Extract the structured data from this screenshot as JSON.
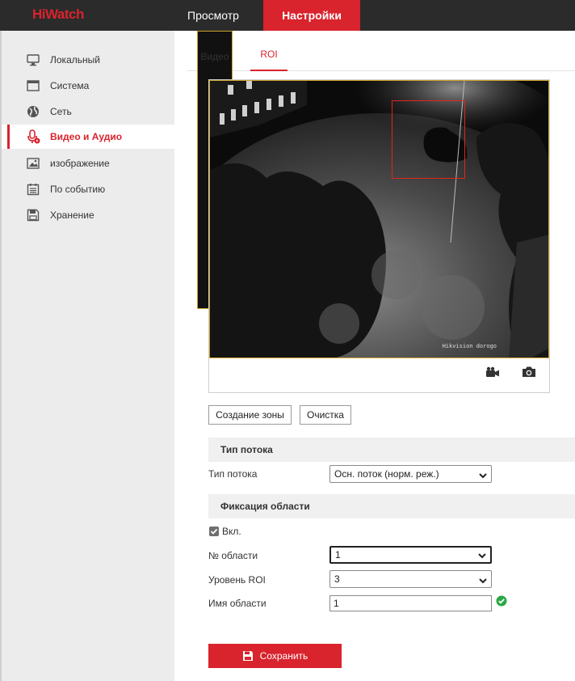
{
  "app": {
    "brand": "HiWatch"
  },
  "top_nav": {
    "view": "Просмотр",
    "settings": "Настройки"
  },
  "sidebar": {
    "items": [
      {
        "label": "Локальный",
        "icon": "monitor-icon"
      },
      {
        "label": "Система",
        "icon": "window-icon"
      },
      {
        "label": "Сеть",
        "icon": "globe-icon"
      },
      {
        "label": "Видео и Аудио",
        "icon": "microphone-icon",
        "active": true
      },
      {
        "label": "изображение",
        "icon": "image-icon"
      },
      {
        "label": "По событию",
        "icon": "calendar-icon"
      },
      {
        "label": "Хранение",
        "icon": "floppy-icon"
      }
    ]
  },
  "tabs": {
    "video": "Видео",
    "roi": "ROI"
  },
  "video": {
    "osd_text": "Hikvision dorogo"
  },
  "buttons": {
    "create_zone": "Создание зоны",
    "clear": "Очистка",
    "save": "Сохранить"
  },
  "stream_section": {
    "title": "Тип потока",
    "type_label": "Тип потока",
    "type_value": "Осн. поток (норм. реж.)"
  },
  "region_section": {
    "title": "Фиксация области",
    "enable_label": "Вкл.",
    "enabled": true,
    "region_no_label": "№ области",
    "region_no_value": "1",
    "roi_level_label": "Уровень ROI",
    "roi_level_value": "3",
    "region_name_label": "Имя области",
    "region_name_value": "1"
  },
  "colors": {
    "accent": "#d9232d",
    "topbar": "#2b2b2b",
    "sidebar": "#ececec",
    "valid": "#2aa845"
  }
}
